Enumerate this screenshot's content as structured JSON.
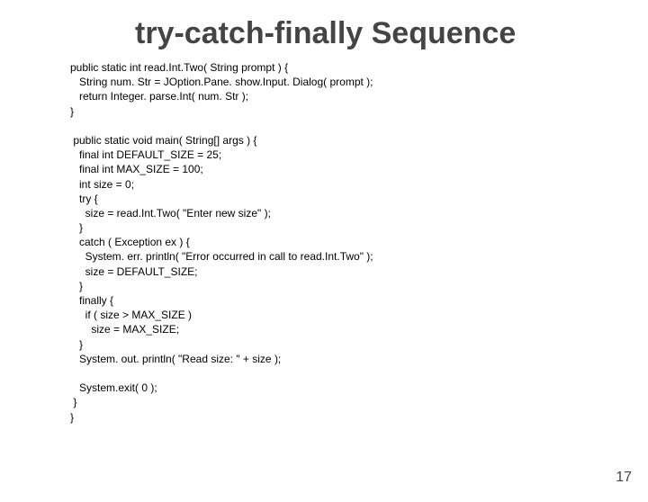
{
  "title": "try-catch-finally Sequence",
  "code": "public static int read.Int.Two( String prompt ) {\n   String num. Str = JOption.Pane. show.Input. Dialog( prompt );\n   return Integer. parse.Int( num. Str );\n}\n\n public static void main( String[] args ) {\n   final int DEFAULT_SIZE = 25;\n   final int MAX_SIZE = 100;\n   int size = 0;\n   try {\n     size = read.Int.Two( \"Enter new size\" );\n   }\n   catch ( Exception ex ) {\n     System. err. println( \"Error occurred in call to read.Int.Two\" );\n     size = DEFAULT_SIZE;\n   }\n   finally {\n     if ( size > MAX_SIZE )\n       size = MAX_SIZE;\n   }\n   System. out. println( \"Read size: \" + size );\n\n   System.exit( 0 );\n }\n}",
  "page_number": "17"
}
